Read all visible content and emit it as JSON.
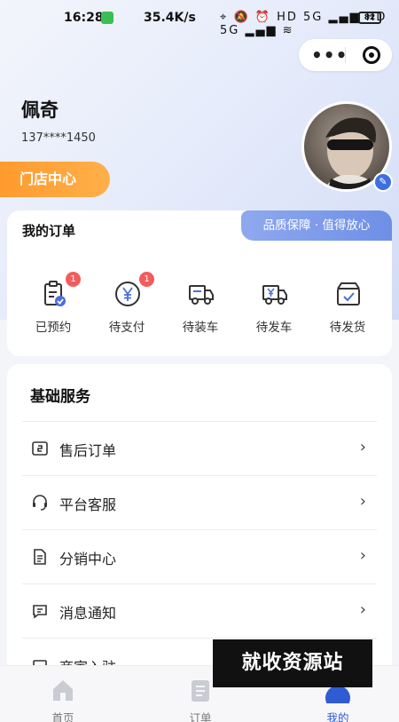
{
  "status_bar": {
    "time": "16:28",
    "network_speed": "35.4K/s",
    "icons": "⌖ 🔕 ⏰ HD 5G ▂▄▆ HD 5G ▂▄▆ ≋",
    "battery": "82"
  },
  "capsule": {
    "more_icon": "more-dots-icon",
    "close_icon": "target-icon"
  },
  "profile": {
    "name": "佩奇",
    "phone": "137****1450",
    "store_center_label": "门店中心",
    "avatar_edit_icon": "edit-pencil-icon"
  },
  "orders": {
    "title": "我的订单",
    "guarantee_label": "品质保障 · 值得放心",
    "items": [
      {
        "label": "已预约",
        "icon": "clipboard-check-icon",
        "badge": "1"
      },
      {
        "label": "待支付",
        "icon": "yen-circle-icon",
        "badge": "1"
      },
      {
        "label": "待装车",
        "icon": "truck-icon",
        "badge": ""
      },
      {
        "label": "待发车",
        "icon": "truck-yen-icon",
        "badge": ""
      },
      {
        "label": "待发货",
        "icon": "box-check-icon",
        "badge": ""
      }
    ]
  },
  "services": {
    "title": "基础服务",
    "items": [
      {
        "label": "售后订单",
        "icon": "after-sale-icon"
      },
      {
        "label": "平台客服",
        "icon": "headset-icon"
      },
      {
        "label": "分销中心",
        "icon": "document-icon"
      },
      {
        "label": "消息通知",
        "icon": "message-icon"
      },
      {
        "label": "商家入驻",
        "icon": "store-icon"
      }
    ]
  },
  "bottom_nav": {
    "items": [
      {
        "label": "首页",
        "icon": "home-icon",
        "active": false
      },
      {
        "label": "订单",
        "icon": "order-list-icon",
        "active": false
      },
      {
        "label": "我的",
        "icon": "profile-icon",
        "active": true
      }
    ]
  },
  "watermark": "就收资源站",
  "colors": {
    "accent_orange": "#ff9a2e",
    "accent_blue": "#2f5bd3",
    "badge_red": "#f25c5c",
    "guarantee_blue": "#7b98e9"
  }
}
